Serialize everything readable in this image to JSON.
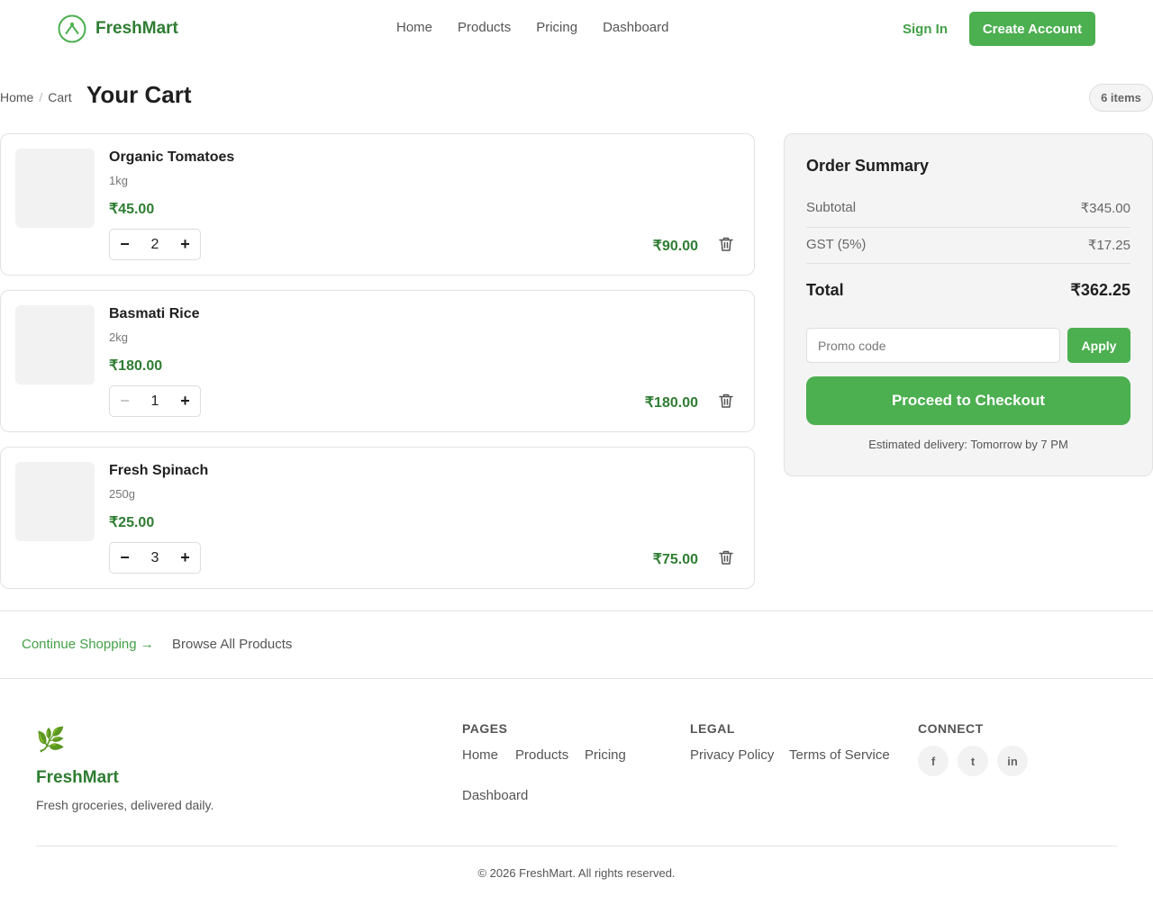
{
  "header": {
    "brand": "FreshMart",
    "nav": [
      "Home",
      "Products",
      "Pricing",
      "Dashboard"
    ],
    "sign_in": "Sign In",
    "create_account": "Create Account"
  },
  "page": {
    "breadcrumb": [
      "Home",
      "Cart"
    ],
    "breadcrumb_sep": "/",
    "title": "Your Cart",
    "items_badge": "6 items"
  },
  "cart": {
    "items": [
      {
        "name": "Organic Tomatoes",
        "unit": "1kg",
        "price": "₹45.00",
        "qty": "2",
        "total": "₹90.00",
        "minus_disabled": false
      },
      {
        "name": "Basmati Rice",
        "unit": "2kg",
        "price": "₹180.00",
        "qty": "1",
        "total": "₹180.00",
        "minus_disabled": true
      },
      {
        "name": "Fresh Spinach",
        "unit": "250g",
        "price": "₹25.00",
        "qty": "3",
        "total": "₹75.00",
        "minus_disabled": false
      }
    ],
    "minus_glyph": "−",
    "plus_glyph": "+",
    "delete_icon": "trash-icon"
  },
  "summary": {
    "title": "Order Summary",
    "subtotal_label": "Subtotal",
    "subtotal_value": "₹345.00",
    "gst_label": "GST (5%)",
    "gst_value": "₹17.25",
    "total_label": "Total",
    "total_value": "₹362.25",
    "promo_placeholder": "Promo code",
    "apply_label": "Apply",
    "checkout_label": "Proceed to Checkout",
    "delivery": "Estimated delivery: Tomorrow by 7 PM"
  },
  "continue_bar": {
    "continue_label": "Continue Shopping →",
    "browse_label": "Browse All Products"
  },
  "footer": {
    "brand_icon": "🌿",
    "brand": "FreshMart",
    "tagline": "Fresh groceries, delivered daily.",
    "pages_heading": "PAGES",
    "pages_links": [
      "Home",
      "Products",
      "Pricing",
      "Dashboard"
    ],
    "legal_heading": "LEGAL",
    "legal_links": [
      "Privacy Policy",
      "Terms of Service"
    ],
    "connect_heading": "CONNECT",
    "social": [
      "f",
      "t",
      "in"
    ],
    "copyright": "© 2026 FreshMart. All rights reserved."
  },
  "colors": {
    "brand_green": "#4caf50",
    "brand_green_dark": "#2e7d32",
    "text": "#1f1f1f",
    "muted": "#555555",
    "panel_bg": "#f4f4f4"
  }
}
